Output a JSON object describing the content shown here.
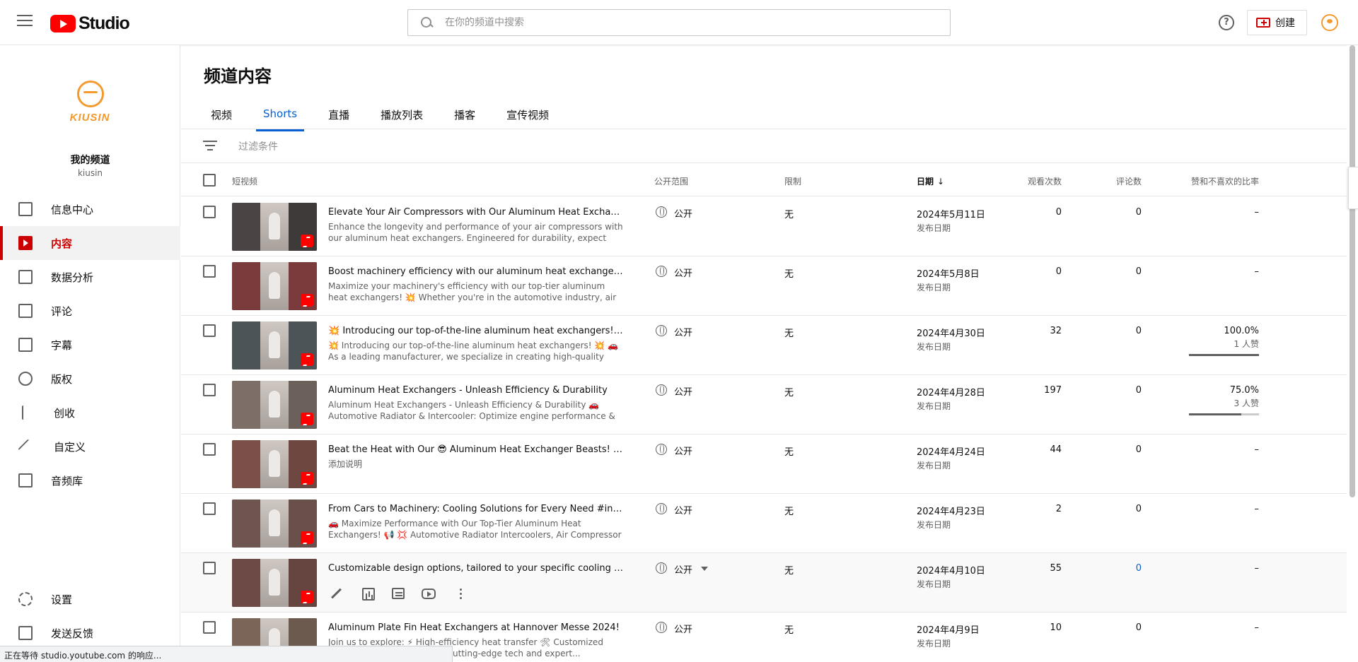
{
  "topbar": {
    "logo_text": "Studio",
    "search_placeholder": "在你的频道中搜索",
    "help_label": "?",
    "create_label": "创建"
  },
  "sidebar": {
    "channel_brand": "KIUSIN",
    "channel_label": "我的频道",
    "channel_handle": "kiusin",
    "items": [
      {
        "label": "信息中心",
        "icon": "dashboard-icon"
      },
      {
        "label": "内容",
        "icon": "content-icon",
        "active": true
      },
      {
        "label": "数据分析",
        "icon": "analytics-icon"
      },
      {
        "label": "评论",
        "icon": "comments-icon"
      },
      {
        "label": "字幕",
        "icon": "subtitles-icon"
      },
      {
        "label": "版权",
        "icon": "copyright-icon"
      },
      {
        "label": "创收",
        "icon": "monetization-icon"
      },
      {
        "label": "自定义",
        "icon": "customization-icon"
      },
      {
        "label": "音频库",
        "icon": "audio-library-icon"
      }
    ],
    "bottom_items": [
      {
        "label": "设置",
        "icon": "settings-icon"
      },
      {
        "label": "发送反馈",
        "icon": "feedback-icon"
      }
    ]
  },
  "main": {
    "title": "频道内容",
    "tabs": [
      {
        "label": "视频"
      },
      {
        "label": "Shorts",
        "active": true
      },
      {
        "label": "直播"
      },
      {
        "label": "播放列表"
      },
      {
        "label": "播客"
      },
      {
        "label": "宣传视频"
      }
    ],
    "filter_placeholder": "过滤条件",
    "columns": {
      "short": "短视频",
      "visibility": "公开范围",
      "restrictions": "限制",
      "date": "日期",
      "views": "观看次数",
      "comments": "评论数",
      "ratio": "赞和不喜欢的比率"
    },
    "rows": [
      {
        "title": "Elevate Your Air Compressors with Our Aluminum Heat Exchangers!",
        "description": "Enhance the longevity and performance of your air compressors with our aluminum heat exchangers. Engineered for durability, expect unmatched...",
        "visibility": "公开",
        "restrictions": "无",
        "date": "2024年5月11日",
        "date_type": "发布日期",
        "views": "0",
        "comments": "0",
        "ratio": "–",
        "likes": "",
        "bar": 0
      },
      {
        "title": "Boost machinery efficiency with our aluminum heat exchangers. #Stay...",
        "description": "Maximize your machinery's efficiency with our top-tier aluminum heat exchangers! 💥 Whether you're in the automotive industry, air compression,...",
        "visibility": "公开",
        "restrictions": "无",
        "date": "2024年5月8日",
        "date_type": "发布日期",
        "views": "0",
        "comments": "0",
        "ratio": "–",
        "likes": "",
        "bar": 0
      },
      {
        "title": "💥 Introducing our top-of-the-line aluminum heat exchangers! 💥",
        "description": "💥 Introducing our top-of-the-line aluminum heat exchangers! 💥 🚗 As a leading manufacturer, we specialize in creating high-quality automotive...",
        "visibility": "公开",
        "restrictions": "无",
        "date": "2024年4月30日",
        "date_type": "发布日期",
        "views": "32",
        "comments": "0",
        "ratio": "100.0%",
        "likes": "1 人赞",
        "bar": 1.0
      },
      {
        "title": "Aluminum Heat Exchangers - Unleash Efficiency & Durability",
        "description": "Aluminum Heat Exchangers - Unleash Efficiency & Durability 🚗 Automotive Radiator & Intercooler: Optimize engine performance & fuel efficiency. ⚡ Ai...",
        "visibility": "公开",
        "restrictions": "无",
        "date": "2024年4月28日",
        "date_type": "发布日期",
        "views": "197",
        "comments": "0",
        "ratio": "75.0%",
        "likes": "3 人赞",
        "bar": 0.75
      },
      {
        "title": "Beat the Heat with Our 😎 Aluminum Heat Exchanger Beasts! 🔥#interc...",
        "description": "添加说明",
        "visibility": "公开",
        "restrictions": "无",
        "date": "2024年4月24日",
        "date_type": "发布日期",
        "views": "44",
        "comments": "0",
        "ratio": "–",
        "likes": "",
        "bar": 0
      },
      {
        "title": "From Cars to Machinery: Cooling Solutions for Every Need #intercooler ...",
        "description": "🚗 Maximize Performance with Our Top-Tier Aluminum Heat Exchangers! 📢 💢 Automotive Radiator Intercoolers, Air Compressor Heat Exchangers,...",
        "visibility": "公开",
        "restrictions": "无",
        "date": "2024年4月23日",
        "date_type": "发布日期",
        "views": "2",
        "comments": "0",
        "ratio": "–",
        "likes": "",
        "bar": 0
      },
      {
        "title": "Customizable design options, tailored to your specific cooling requirem...",
        "description": "",
        "visibility": "公开",
        "restrictions": "无",
        "date": "2024年4月10日",
        "date_type": "发布日期",
        "views": "55",
        "comments": "0",
        "ratio": "–",
        "likes": "",
        "bar": 0,
        "hover": true
      },
      {
        "title": "Aluminum Plate Fin Heat Exchangers at Hannover Messe 2024!",
        "description": "Join us to explore: ⚡ High-efficiency heat transfer 🛠 Customized solutions Visit our booth for cutting-edge tech and expert...",
        "visibility": "公开",
        "restrictions": "无",
        "date": "2024年4月9日",
        "date_type": "发布日期",
        "views": "10",
        "comments": "0",
        "ratio": "–",
        "likes": "",
        "bar": 0
      }
    ]
  },
  "status_bar": "正在等待 studio.youtube.com 的响应...",
  "colors": {
    "accent_red": "#cc0000",
    "link_blue": "#065fd4",
    "brand_orange": "#f29a2e"
  }
}
